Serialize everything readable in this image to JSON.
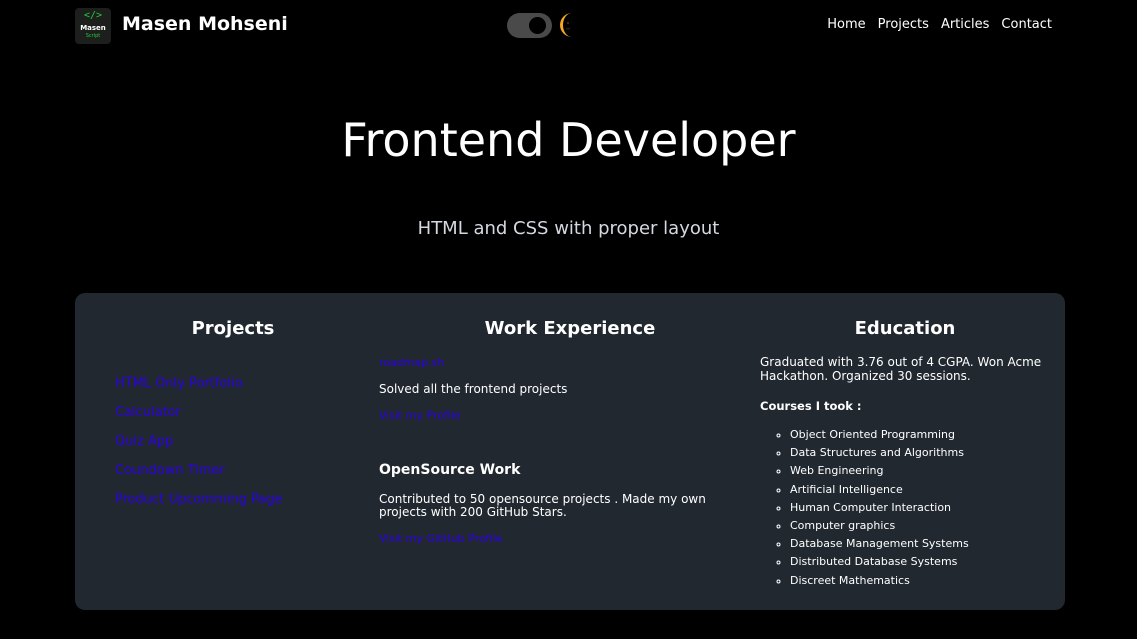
{
  "header": {
    "logo": {
      "code": "</>",
      "line1": "Masen",
      "line2": "Script"
    },
    "site_name": "Masen Mohseni",
    "theme_toggle": {
      "state": "on",
      "icon": "moon-icon"
    },
    "nav": [
      "Home",
      "Projects",
      "Articles",
      "Contact"
    ]
  },
  "hero": {
    "title": "Frontend Developer",
    "subtitle": "HTML and CSS with proper layout"
  },
  "projects": {
    "title": "Projects",
    "items": [
      "HTML Only Portfolio",
      "Calculator",
      "Quiz App",
      "Coundown Timer",
      "Product Upcomming Page"
    ]
  },
  "work": {
    "title": "Work Experience",
    "company_link": "roadmap.sh",
    "company_desc": "Solved all the frontend projects",
    "profile_link": "Visit my Profile",
    "opensource_title": "OpenSource Work",
    "opensource_desc_line1": "Contributed to 50 opensource projects . Made my own",
    "opensource_desc_line2": "projects with 200 GitHub Stars.",
    "github_link": "Visit my GitHub Profile"
  },
  "education": {
    "title": "Education",
    "summary_line1": "Graduated with 3.76 out of 4 CGPA. Won Acme",
    "summary_line2": "Hackathon. Organized 30 sessions.",
    "courses_title": "Courses I took :",
    "courses": [
      "Object Oriented Programming",
      "Data Structures and Algorithms",
      "Web Engineering",
      "Artificial Intelligence",
      "Human Computer Interaction",
      "Computer graphics",
      "Database Management Systems",
      "Distributed Database Systems",
      "Discreet Mathematics"
    ]
  },
  "colors": {
    "background": "#000000",
    "card": "#212830",
    "link": "#2d00e6",
    "logo_accent": "#27c93f",
    "moon": "#f5a623"
  }
}
